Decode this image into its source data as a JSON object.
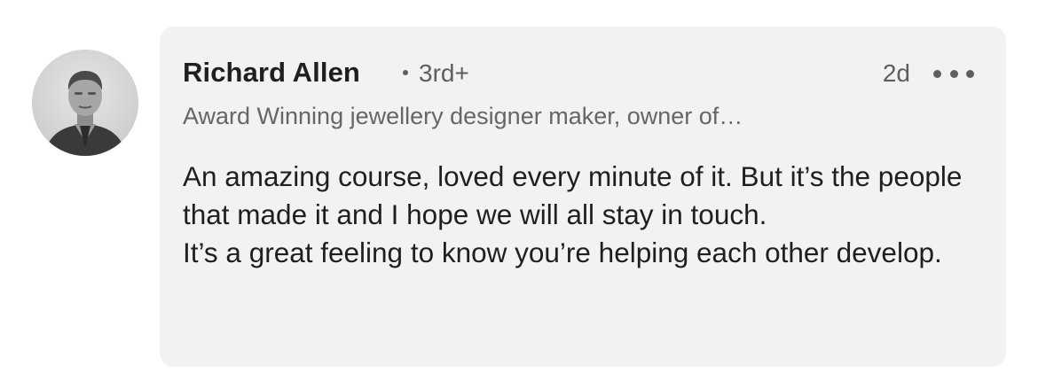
{
  "comment": {
    "author": {
      "name": "Richard Allen",
      "connection_degree": "3rd+",
      "headline": "Award Winning jewellery designer maker, owner of…"
    },
    "timestamp": "2d",
    "paragraphs": [
      "An amazing course, loved every minute of it. But it’s the people that made it and I hope we will all stay in touch.",
      "It’s a great feeling to know you’re helping each other develop."
    ]
  },
  "icons": {
    "more": "more-options-icon",
    "avatar": "profile-photo"
  },
  "colors": {
    "bubble_background": "#f2f2f2",
    "primary_text": "#1f1f1f",
    "secondary_text": "#5e5e5e"
  }
}
